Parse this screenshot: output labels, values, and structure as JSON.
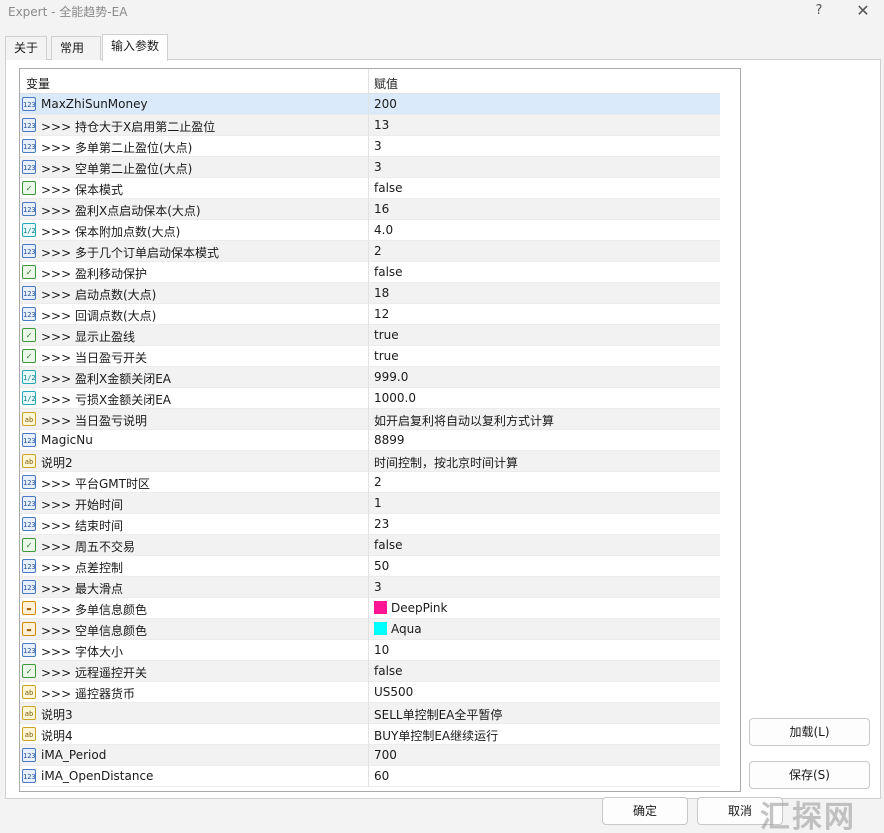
{
  "window": {
    "title": "Expert - 全能趋势-EA",
    "help": "?",
    "close": "✕"
  },
  "tabs": [
    {
      "label": "关于"
    },
    {
      "label": "常用"
    },
    {
      "label": "输入参数"
    }
  ],
  "grid": {
    "col_name": "变量",
    "col_value": "赋值",
    "rows": [
      {
        "type": "int",
        "name": "MaxZhiSunMoney",
        "value": "200"
      },
      {
        "type": "int",
        "name": ">>>  持仓大于X启用第二止盈位",
        "value": "13"
      },
      {
        "type": "int",
        "name": ">>>  多单第二止盈位(大点)",
        "value": "3"
      },
      {
        "type": "int",
        "name": ">>>  空单第二止盈位(大点)",
        "value": "3"
      },
      {
        "type": "bool",
        "name": ">>>  保本模式",
        "value": "false"
      },
      {
        "type": "int",
        "name": ">>>  盈利X点启动保本(大点)",
        "value": "16"
      },
      {
        "type": "dbl",
        "name": ">>>  保本附加点数(大点)",
        "value": "4.0"
      },
      {
        "type": "int",
        "name": ">>>  多于几个订单启动保本模式",
        "value": "2"
      },
      {
        "type": "bool",
        "name": ">>>  盈利移动保护",
        "value": "false"
      },
      {
        "type": "int",
        "name": ">>>  启动点数(大点)",
        "value": "18"
      },
      {
        "type": "int",
        "name": ">>>  回调点数(大点)",
        "value": "12"
      },
      {
        "type": "bool",
        "name": ">>>  显示止盈线",
        "value": "true"
      },
      {
        "type": "bool",
        "name": ">>>  当日盈亏开关",
        "value": "true"
      },
      {
        "type": "dbl",
        "name": ">>>  盈利X金额关闭EA",
        "value": "999.0"
      },
      {
        "type": "dbl",
        "name": ">>>  亏损X金额关闭EA",
        "value": "1000.0"
      },
      {
        "type": "str",
        "name": ">>>  当日盈亏说明",
        "value": "如开启复利将自动以复利方式计算"
      },
      {
        "type": "int",
        "name": "MagicNu",
        "value": "8899"
      },
      {
        "type": "str",
        "name": "说明2",
        "value": "时间控制，按北京时间计算"
      },
      {
        "type": "int",
        "name": ">>>  平台GMT时区",
        "value": "2"
      },
      {
        "type": "int",
        "name": ">>>  开始时间",
        "value": "1"
      },
      {
        "type": "int",
        "name": ">>>  结束时间",
        "value": "23"
      },
      {
        "type": "bool",
        "name": ">>>  周五不交易",
        "value": "false"
      },
      {
        "type": "int",
        "name": ">>>  点差控制",
        "value": "50"
      },
      {
        "type": "int",
        "name": ">>>  最大滑点",
        "value": "3"
      },
      {
        "type": "clr",
        "name": ">>>  多单信息颜色",
        "value": "DeepPink",
        "swatch": "#ff1493"
      },
      {
        "type": "clr",
        "name": ">>>  空单信息颜色",
        "value": "Aqua",
        "swatch": "#00ffff"
      },
      {
        "type": "int",
        "name": ">>>  字体大小",
        "value": "10"
      },
      {
        "type": "bool",
        "name": ">>>  远程遥控开关",
        "value": "false"
      },
      {
        "type": "str",
        "name": ">>>  遥控器货币",
        "value": "US500"
      },
      {
        "type": "str",
        "name": "说明3",
        "value": "SELL单控制EA全平暂停"
      },
      {
        "type": "str",
        "name": "说明4",
        "value": "BUY单控制EA继续运行"
      },
      {
        "type": "int",
        "name": "iMA_Period",
        "value": "700"
      },
      {
        "type": "int",
        "name": "iMA_OpenDistance",
        "value": "60"
      }
    ]
  },
  "icons": {
    "int": "123",
    "dbl": "1/2",
    "bool": "✓",
    "str": "ab",
    "clr": "▬"
  },
  "buttons": {
    "load": "加载(L)",
    "save": "保存(S)",
    "ok": "确定",
    "cancel": "取消"
  },
  "watermark": "汇探网"
}
